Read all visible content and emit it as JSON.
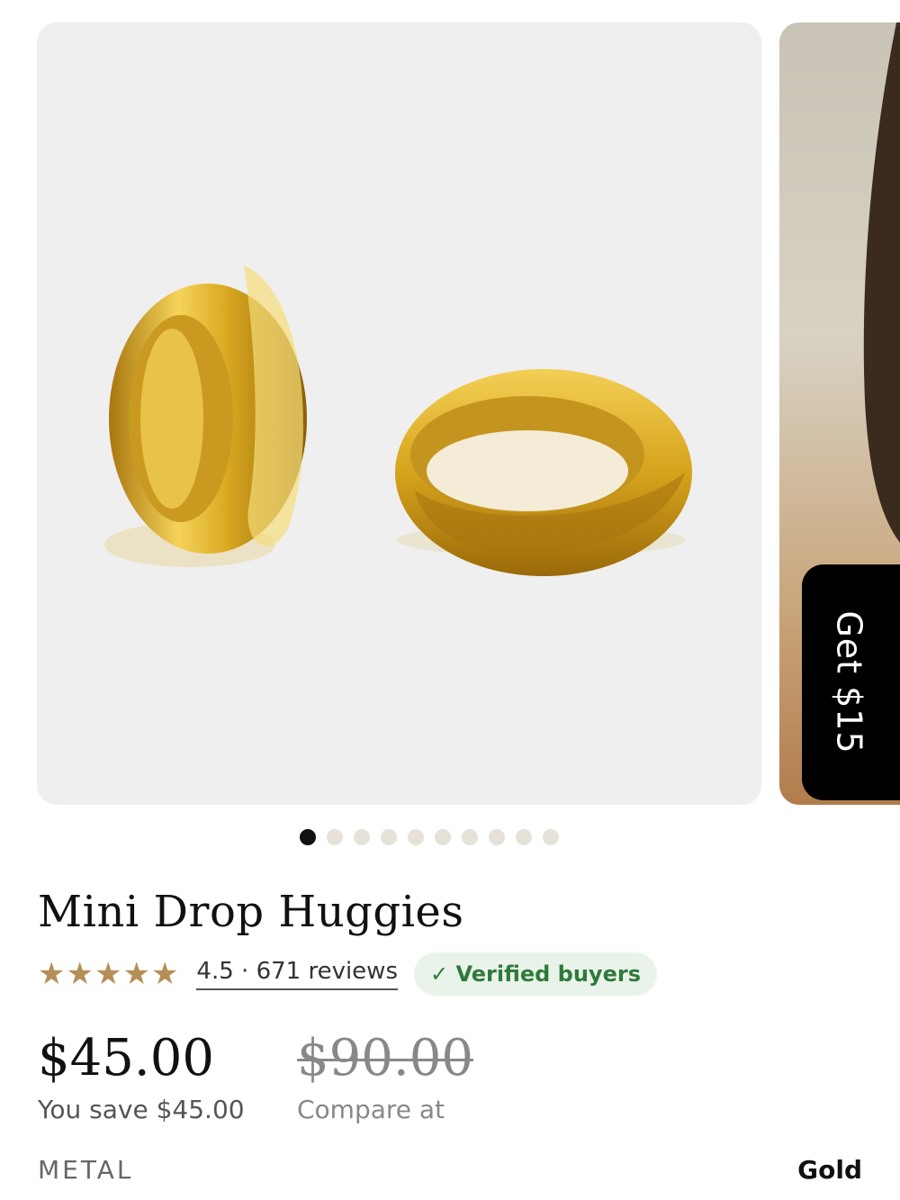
{
  "promo": {
    "tab_label": "Get $15"
  },
  "gallery": {
    "total_images": 10,
    "active_index": 0
  },
  "product": {
    "title": "Mini Drop Huggies",
    "rating_value": 4.5,
    "rating_text": "4.5 · 671 reviews",
    "badge": "✓ Verified buyers",
    "price": "$45.00",
    "compare_price": "$90.00",
    "save_text": "You save $45.00",
    "compare_label": "Compare at",
    "option_label": "METAL",
    "option_value": "Gold"
  },
  "colors": {
    "star": "#b68e57",
    "badge_bg": "#e9f3ea",
    "badge_text": "#2f7a3b",
    "gold": "#d4a62a"
  }
}
